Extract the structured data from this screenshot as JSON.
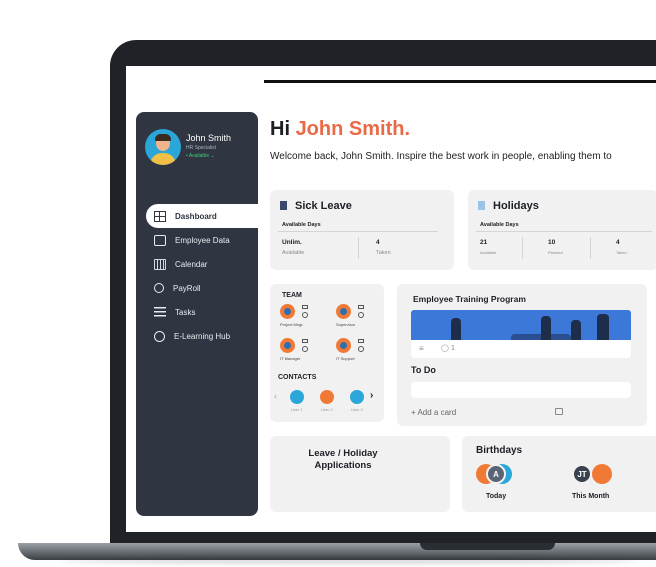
{
  "sidebar": {
    "user": {
      "name": "John Smith",
      "role": "HR Specialist",
      "status": "• Available"
    },
    "items": [
      {
        "label": "Dashboard",
        "icon": "dashboard-grid-icon",
        "active": true
      },
      {
        "label": "Employee Data",
        "icon": "folder-icon"
      },
      {
        "label": "Calendar",
        "icon": "calendar-icon"
      },
      {
        "label": "PayRoll",
        "icon": "payroll-icon"
      },
      {
        "label": "Tasks",
        "icon": "tasks-list-icon"
      },
      {
        "label": "E-Learning Hub",
        "icon": "learning-icon"
      }
    ]
  },
  "greeting": {
    "hi": "Hi",
    "name": "John Smith.",
    "welcome": "Welcome back, John Smith. Inspire the best work in people, enabling them to"
  },
  "sick_leave": {
    "title": "Sick Leave",
    "subtitle": "Available Days",
    "stats": [
      {
        "value": "Unlim.",
        "label": "Available"
      },
      {
        "value": "4",
        "label": "Taken"
      }
    ]
  },
  "holidays": {
    "title": "Holidays",
    "subtitle": "Available Days",
    "stats": [
      {
        "value": "21",
        "label": "Available"
      },
      {
        "value": "10",
        "label": "Planned"
      },
      {
        "value": "4",
        "label": "Taken"
      }
    ]
  },
  "team": {
    "title": "TEAM",
    "members": [
      {
        "role": "Project Mngr."
      },
      {
        "role": "Supervisor"
      },
      {
        "role": "IT Manager"
      },
      {
        "role": "IT Support"
      }
    ],
    "contacts_title": "CONTACTS",
    "contacts": [
      {
        "name": "User 1"
      },
      {
        "name": "User 2"
      },
      {
        "name": "User 3"
      }
    ]
  },
  "training": {
    "title": "Employee Training Program",
    "comments": "1",
    "todo_title": "To Do",
    "add_card": "+ Add a card"
  },
  "leave_apps": {
    "title": "Leave / Holiday Applications"
  },
  "birthdays": {
    "title": "Birthdays",
    "today_label": "Today",
    "today_initial": "A",
    "month_label": "This Month",
    "month_initials": "JT"
  },
  "colors": {
    "accent": "#ea6a47",
    "sidebar": "#2f3541",
    "sick": "#3a4a6b",
    "holiday": "#9cc3e6"
  }
}
